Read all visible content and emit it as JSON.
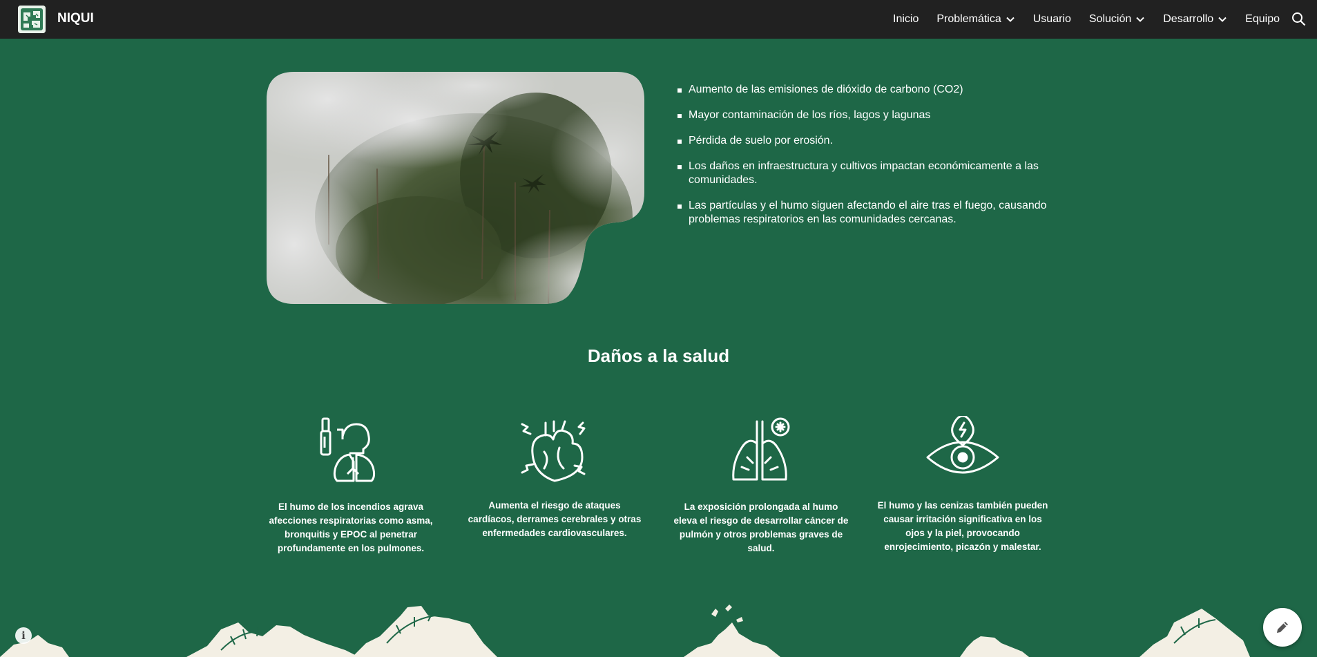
{
  "site": {
    "title": "NIQUI"
  },
  "nav": {
    "items": [
      {
        "label": "Inicio",
        "has_dropdown": false
      },
      {
        "label": "Problemática",
        "has_dropdown": true
      },
      {
        "label": "Usuario",
        "has_dropdown": false
      },
      {
        "label": "Solución",
        "has_dropdown": true
      },
      {
        "label": "Desarrollo",
        "has_dropdown": true
      },
      {
        "label": "Equipo",
        "has_dropdown": false
      }
    ],
    "search_icon": "search-icon"
  },
  "hero": {
    "image_icon": "forest-fire-smoke-photo",
    "bullets": [
      "Aumento de las emisiones de dióxido de carbono (CO2)",
      "Mayor contaminación de los ríos, lagos y lagunas",
      "Pérdida de suelo por erosión.",
      "Los daños en infraestructura y cultivos impactan económicamente a las comunidades.",
      "Las partículas y el humo siguen afectando el aire tras el fuego, causando problemas respiratorios en las comunidades cercanas."
    ]
  },
  "health": {
    "title": "Daños a la salud",
    "cards": [
      {
        "icon": "inhaler-lungs-icon",
        "text": "El humo de los incendios agrava afecciones respiratorias como asma, bronquitis y EPOC al penetrar profundamente en los pulmones."
      },
      {
        "icon": "heart-icon",
        "text": "Aumenta el riesgo de ataques cardíacos, derrames cerebrales y otras enfermedades cardiovasculares."
      },
      {
        "icon": "lungs-cancer-icon",
        "text": "La exposición prolongada al humo eleva el riesgo de desarrollar cáncer de pulmón y otros problemas graves de salud."
      },
      {
        "icon": "eye-irritation-icon",
        "text": "El humo y las cenizas también pueden causar irritación significativa en los ojos y la piel, provocando enrojecimiento, picazón y malestar."
      }
    ]
  },
  "colors": {
    "background": "#1e6747",
    "topbar": "#212121",
    "foliage": "#f3efe4"
  }
}
